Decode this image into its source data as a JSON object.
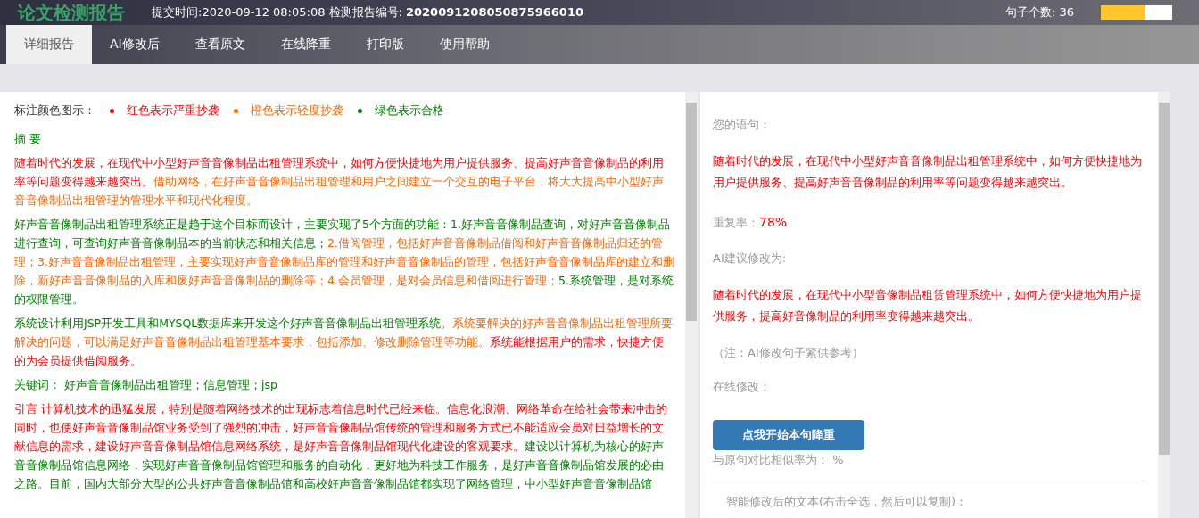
{
  "header": {
    "title": "论文检测报告",
    "submit_label": "提交时间:",
    "submit_time": "2020-09-12 08:05:08",
    "report_label": "检测报告编号:",
    "report_number": "2020091208050875966010",
    "sentence_count": "句子个数: 36",
    "progress": {
      "level": 0.63
    }
  },
  "tabs": [
    {
      "label": "详细报告",
      "selected": true
    },
    {
      "label": "AI修改后",
      "selected": false
    },
    {
      "label": "查看原文",
      "selected": false
    },
    {
      "label": "在线降重",
      "selected": false
    },
    {
      "label": "打印版",
      "selected": false
    },
    {
      "label": "使用帮助",
      "selected": false
    }
  ],
  "legend": {
    "label": "标注颜色图示：",
    "items": [
      {
        "text": "红色表示严重抄袭",
        "color": "#ff0000"
      },
      {
        "text": "橙色表示轻度抄袭",
        "color": "#ff6600"
      },
      {
        "text": "绿色表示合格",
        "color": "#008000"
      }
    ]
  },
  "paragraphs": [
    [
      {
        "kind": "pass",
        "text": "摘 要"
      }
    ],
    [
      {
        "kind": "severe",
        "text": "随着时代的发展，在现代中小型好声音音像制品出租管理系统中，如何方便快捷地为用户提供服务、提高好声音音像制品的利用率等问题变得越来越突出。"
      },
      {
        "kind": "light",
        "text": "借助网络，在好声音音像制品出租管理和用户之间建立一个交互的电子平台，将大大提高中小型好声音音像制品出租管理的管理水平和现代化程度。"
      }
    ],
    [
      {
        "kind": "pass",
        "text": "好声音音像制品出租管理系统正是趋于这个目标而设计，主要实现了5个方面的功能：1.好声音音像制品查询，对好声音音像制品进行查询，可查询好声音音像制品本的当前状态和相关信息；"
      },
      {
        "kind": "light",
        "text": "2.借阅管理，包括好声音音像制品借阅和好声音音像制品归还的管理；3.好声音音像制品出租管理，主要实现好声音音像制品库的管理和好声音音像制品的管理，包括好声音音像制品库的建立和删除，新好声音音像制品的入库和废好声音音像制品的删除等；4.会员管理，是对会员信息和借阅进行管理；"
      },
      {
        "kind": "pass",
        "text": "5.系统管理，是对系统的权限管理。"
      }
    ],
    [
      {
        "kind": "pass",
        "text": "系统设计利用JSP开发工具和MYSQL数据库来开发这个好声音音像制品出租管理系统。"
      },
      {
        "kind": "light",
        "text": "系统要解决的好声音音像制品出租管理所要解决的问题，可以满足好声音音像制品出租管理基本要求，包括添加、修改删除管理等功能。"
      },
      {
        "kind": "severe",
        "text": "系统能根据用户的需求，快捷方便的为会员提供借阅服务。"
      }
    ],
    [
      {
        "kind": "pass",
        "text": "关键词： 好声音音像制品出租管理；信息管理；jsp"
      }
    ],
    [
      {
        "kind": "severe",
        "text": "引言 计算机技术的迅猛发展，特别是随着网络技术的出现标志着信息时代已经来临。信息化浪潮、网络革命在给社会带来冲击的同时，也使好声音音像制品馆业务受到了强烈的冲击，好声音音像制品馆传统的管理和服务方式已不能适应会员对日益增长的文献信息的需求，建设好声音音像制品馆信息网络系统，是好声音音像制品馆现代化建设的客观要求。"
      },
      {
        "kind": "pass",
        "text": "建设以计算机为核心的好声音音像制品馆信息网络，实现好声音音像制品馆管理和服务的自动化，更好地为科技工作服务，是好声音音像制品馆发展的必由之路。目前，国内大部分大型的公共好声音音像制品馆和高校好声音音像制品馆都实现了网络管理，中小型好声音音像制品馆"
      }
    ]
  ],
  "detail": {
    "sentence_label": "您的语句：",
    "sentence": "随着时代的发展，在现代中小型好声音音像制品出租管理系统中，如何方便快捷地为用户提供服务、提高好声音音像制品的利用率等问题变得越来越突出。",
    "rate_label": "重复率：",
    "rate": "78%",
    "ai_label": "AI建议修改为:",
    "ai_sentence": "随着时代的发展，在现代中小型音像制品租赁管理系统中，如何方便快捷地为用户提供服务，提高好音像制品的利用率变得越来越突出。",
    "note": "（注：AI修改句子紧供参考）",
    "online_label": "在线修改：",
    "button": "点我开始本句降重",
    "similarity": "与原句对比相似率为：  %",
    "result_label": "智能修改后的文本(右击全选，然后可以复制)："
  }
}
